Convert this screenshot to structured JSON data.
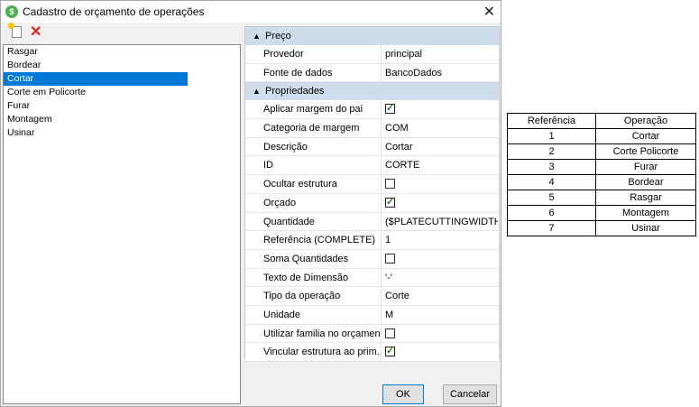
{
  "window": {
    "title": "Cadastro de orçamento de operações"
  },
  "operations_list": [
    "Rasgar",
    "Bordear",
    "Cortar",
    "Corte em Policorte",
    "Furar",
    "Montagem",
    "Usinar"
  ],
  "selected_index": 2,
  "categories": {
    "preco": "Preço",
    "propriedades": "Propriedades"
  },
  "preco_rows": [
    {
      "name": "Provedor",
      "value": "principal"
    },
    {
      "name": "Fonte de dados",
      "value": "BancoDados"
    }
  ],
  "prop_rows": [
    {
      "name": "Aplicar margem do pai",
      "type": "check",
      "checked": true
    },
    {
      "name": "Categoria de margem",
      "value": "COM"
    },
    {
      "name": "Descrição",
      "value": "Cortar"
    },
    {
      "name": "ID",
      "value": "CORTE"
    },
    {
      "name": "Ocultar estrutura",
      "type": "check",
      "checked": false
    },
    {
      "name": "Orçado",
      "type": "check",
      "checked": true
    },
    {
      "name": "Quantidade",
      "value": "($PLATECUTTINGWIDTHBUI"
    },
    {
      "name": "Referência (COMPLETE)",
      "value": "1"
    },
    {
      "name": "Soma Quantidades",
      "type": "check",
      "checked": false
    },
    {
      "name": "Texto de Dimensão",
      "value": "'-'"
    },
    {
      "name": "Tipo da operação",
      "value": "Corte"
    },
    {
      "name": "Unidade",
      "value": "M"
    },
    {
      "name": "Utilizar familia no orçamen...",
      "type": "check",
      "checked": false
    },
    {
      "name": "Vincular estrutura ao prim...",
      "type": "check",
      "checked": true
    }
  ],
  "buttons": {
    "ok": "OK",
    "cancel": "Cancelar"
  },
  "ref_table": {
    "headers": [
      "Referência",
      "Operação"
    ],
    "rows": [
      [
        "1",
        "Cortar"
      ],
      [
        "2",
        "Corte Policorte"
      ],
      [
        "3",
        "Furar"
      ],
      [
        "4",
        "Bordear"
      ],
      [
        "5",
        "Rasgar"
      ],
      [
        "6",
        "Montagem"
      ],
      [
        "7",
        "Usinar"
      ]
    ]
  },
  "colors": {
    "selection": "#0078d7",
    "category_bg": "#cfdcec",
    "delete_icon": "#e02020"
  }
}
